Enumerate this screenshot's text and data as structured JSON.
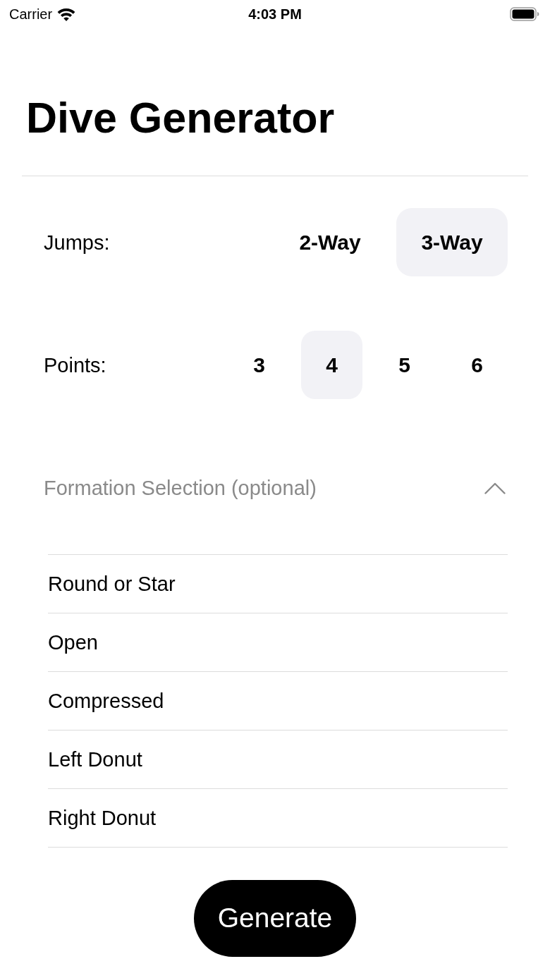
{
  "status_bar": {
    "carrier": "Carrier",
    "time": "4:03 PM"
  },
  "title": "Dive Generator",
  "jumps": {
    "label": "Jumps:",
    "options": [
      {
        "label": "2-Way",
        "selected": false
      },
      {
        "label": "3-Way",
        "selected": true
      }
    ]
  },
  "points": {
    "label": "Points:",
    "options": [
      {
        "label": "3",
        "selected": false
      },
      {
        "label": "4",
        "selected": true
      },
      {
        "label": "5",
        "selected": false
      },
      {
        "label": "6",
        "selected": false
      }
    ]
  },
  "formation": {
    "label": "Formation Selection (optional)",
    "expanded": true,
    "items": [
      "Round or Star",
      "Open",
      "Compressed",
      "Left Donut",
      "Right Donut"
    ]
  },
  "generate_button": "Generate"
}
